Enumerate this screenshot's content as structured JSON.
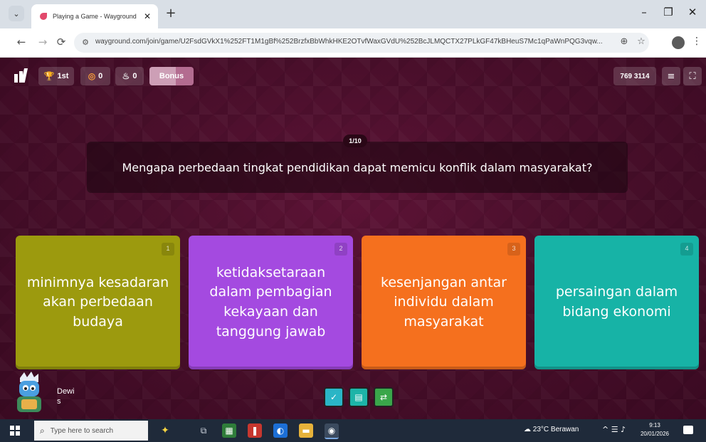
{
  "browser": {
    "tab_title": "Playing a Game - Wayground",
    "tab_close": "✕",
    "new_tab": "+",
    "url": "wayground.com/join/game/U2FsdGVkX1%252FT1M1gBf%252BrzfxBbWhkHKE2OTvfWaxGVdU%252BcJLMQCTX27PLkGF47kBHeuS7Mc1qPaWnPQG3vqw...",
    "window_controls": {
      "minimize": "–",
      "maximize": "❐",
      "close": "✕"
    },
    "nav": {
      "back": "←",
      "forward": "→",
      "reload": "⟳"
    },
    "colors": {
      "tabbar": "#d9dfe6",
      "toolbar": "#ffffff"
    }
  },
  "game": {
    "rank": "1st",
    "streak_count": "0",
    "score_count": "0",
    "bonus_label": "Bonus",
    "bonus_progress": 0.6,
    "game_code": "769 3114",
    "question_counter": "1/10",
    "question": "Mengapa perbedaan tingkat pendidikan dapat memicu konflik dalam masyarakat?",
    "options": [
      {
        "number": "1",
        "text": "minimnya kesadaran akan perbedaan budaya",
        "color": "#9c9a0e"
      },
      {
        "number": "2",
        "text": "ketidaksetaraan dalam pembagian kekayaan dan tanggung jawab",
        "color": "#a44ae0"
      },
      {
        "number": "3",
        "text": "kesenjangan antar individu dalam masyarakat",
        "color": "#f5701e"
      },
      {
        "number": "4",
        "text": "persaingan dalam bidang ekonomi",
        "color": "#17b3a6"
      }
    ],
    "player_name_line1": "Dewi",
    "player_name_line2": "s",
    "powerups": [
      {
        "name": "power-up-1",
        "color": "#2ab5c6",
        "icon": "✓"
      },
      {
        "name": "power-up-2",
        "color": "#1db4a8",
        "icon": "▤"
      },
      {
        "name": "power-up-3",
        "color": "#3aa64a",
        "icon": "⇄"
      }
    ],
    "colors": {
      "background": "#4a0f2b"
    }
  },
  "taskbar": {
    "search_placeholder": "Type here to search",
    "weather": "23°C  Berawan",
    "time": "9:13",
    "date": "20/01/2026"
  }
}
